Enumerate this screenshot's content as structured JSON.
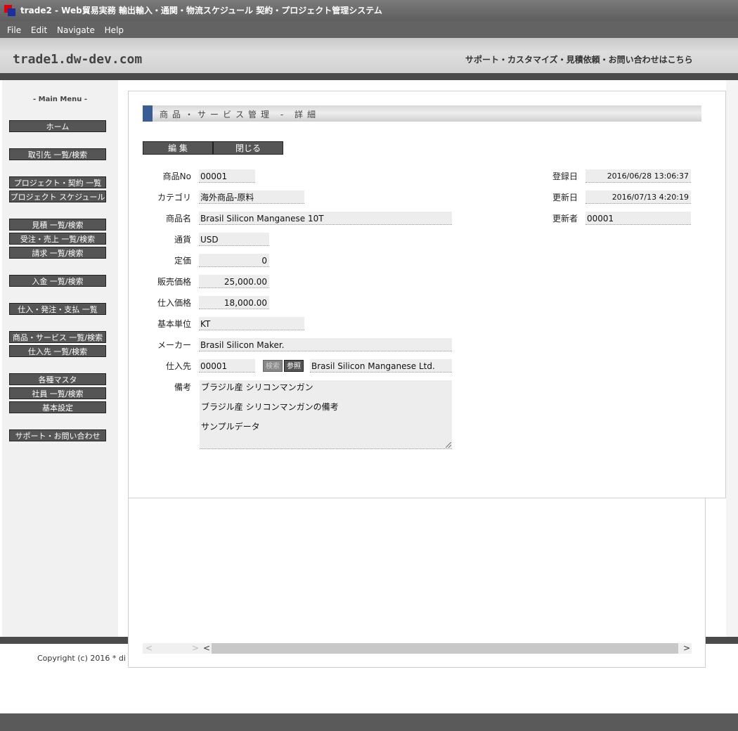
{
  "window": {
    "title": "trade2 - Web貿易実務 輸出輸入・通関・物流スケジュール 契約・プロジェクト管理システム"
  },
  "menubar": {
    "items": [
      "File",
      "Edit",
      "Navigate",
      "Help"
    ]
  },
  "site": {
    "logo": "trade1.dw-dev.com",
    "support": "サポート・カスタマイズ・見積依頼・お問い合わせはこちら"
  },
  "sidebar": {
    "title": "- Main Menu -",
    "items": [
      "ホーム",
      "取引先 一覧/検索",
      "プロジェクト・契約 一覧",
      "プロジェクト スケジュール",
      "見積 一覧/検索",
      "受注・売上 一覧/検索",
      "請求 一覧/検索",
      "入金 一覧/検索",
      "仕入・発注・支払 一覧",
      "商品・サービス 一覧/検索",
      "仕入先 一覧/検索",
      "各種マスタ",
      "社員 一覧/検索",
      "基本設定",
      "サポート・お問い合わせ"
    ]
  },
  "page": {
    "title": "商品・サービス管理 - 詳細",
    "actions": {
      "edit": "編 集",
      "close": "閉じる"
    }
  },
  "form": {
    "labels": {
      "product_no": "商品No",
      "category": "カテゴリ",
      "product_name": "商品名",
      "currency": "通貨",
      "list_price": "定価",
      "sale_price": "販売価格",
      "purchase_price": "仕入価格",
      "unit": "基本単位",
      "maker": "メーカー",
      "supplier": "仕入先",
      "note": "備考",
      "created": "登録日",
      "updated": "更新日",
      "updated_by": "更新者"
    },
    "values": {
      "product_no": "00001",
      "category": "海外商品-原料",
      "product_name": "Brasil Silicon Manganese 10T",
      "currency": "USD",
      "list_price": "0",
      "sale_price": "25,000.00",
      "purchase_price": "18,000.00",
      "unit": "KT",
      "maker": "Brasil Silicon Maker.",
      "supplier_code": "00001",
      "supplier_name": "Brasil Silicon Manganese Ltd.",
      "created": "2016/06/28 13:06:37",
      "updated": "2016/07/13 4:20:19",
      "updated_by": "00001"
    },
    "supplier_buttons": {
      "search": "検索",
      "lookup": "参照"
    },
    "note_lines": [
      "ブラジル産 シリコンマンガン",
      "ブラジル産 シリコンマンガンの備考",
      "サンプルデータ"
    ]
  },
  "footer": {
    "copyright": "Copyright (c) 2016 * di"
  }
}
